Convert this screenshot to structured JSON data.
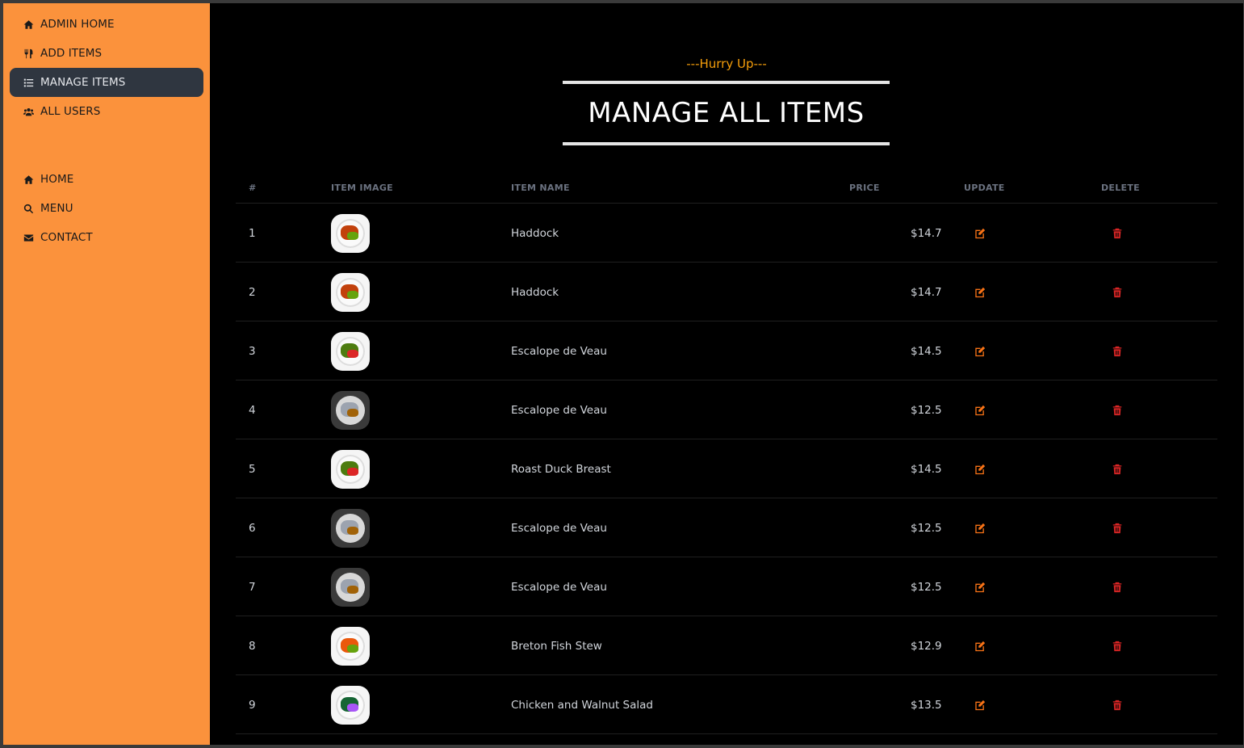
{
  "sidebar": {
    "admin_items": [
      {
        "label": "ADMIN HOME",
        "icon": "home-icon"
      },
      {
        "label": "ADD ITEMS",
        "icon": "utensils-icon"
      },
      {
        "label": "MANAGE ITEMS",
        "icon": "list-icon",
        "active": true
      },
      {
        "label": "ALL USERS",
        "icon": "users-icon"
      }
    ],
    "site_items": [
      {
        "label": "HOME",
        "icon": "home-icon"
      },
      {
        "label": "MENU",
        "icon": "search-icon"
      },
      {
        "label": "CONTACT",
        "icon": "envelope-icon"
      }
    ]
  },
  "header": {
    "subheading": "---Hurry Up---",
    "title": "MANAGE ALL ITEMS"
  },
  "table": {
    "columns": [
      "#",
      "ITEM IMAGE",
      "ITEM NAME",
      "PRICE",
      "UPDATE",
      "DELETE"
    ],
    "rows": [
      {
        "num": "1",
        "name": "Haddock",
        "price": "$14.7"
      },
      {
        "num": "2",
        "name": "Haddock",
        "price": "$14.7"
      },
      {
        "num": "3",
        "name": "Escalope de Veau",
        "price": "$14.5"
      },
      {
        "num": "4",
        "name": "Escalope de Veau",
        "price": "$12.5"
      },
      {
        "num": "5",
        "name": "Roast Duck Breast",
        "price": "$14.5"
      },
      {
        "num": "6",
        "name": "Escalope de Veau",
        "price": "$12.5"
      },
      {
        "num": "7",
        "name": "Escalope de Veau",
        "price": "$12.5"
      },
      {
        "num": "8",
        "name": "Breton Fish Stew",
        "price": "$12.9"
      },
      {
        "num": "9",
        "name": "Chicken and Walnut Salad",
        "price": "$13.5"
      }
    ]
  },
  "colors": {
    "sidebar_bg": "#fb923c",
    "accent": "#f59e0b",
    "update_icon": "#f97316",
    "delete_icon": "#dc2626"
  }
}
